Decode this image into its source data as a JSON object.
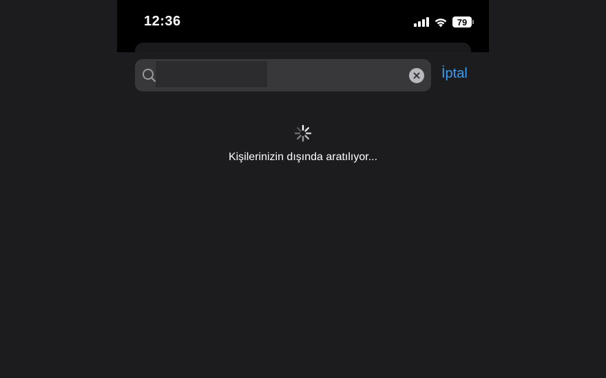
{
  "status_bar": {
    "time": "12:36",
    "battery_level": "79",
    "signal_bars": 4,
    "icons": [
      "cellular-signal-icon",
      "wifi-icon",
      "battery-icon"
    ]
  },
  "search": {
    "query": "",
    "query_redacted": true,
    "icon": "search-icon",
    "clear_icon": "clear-x-icon"
  },
  "cancel_label": "İptal",
  "loading": {
    "message": "Kişilerinizin dışında aratılıyor...",
    "icon": "activity-spinner-icon"
  },
  "colors": {
    "background": "#1c1c1e",
    "status_bar": "#000000",
    "search_field": "#38383a",
    "accent": "#3d9df3",
    "text": "#ffffff"
  }
}
